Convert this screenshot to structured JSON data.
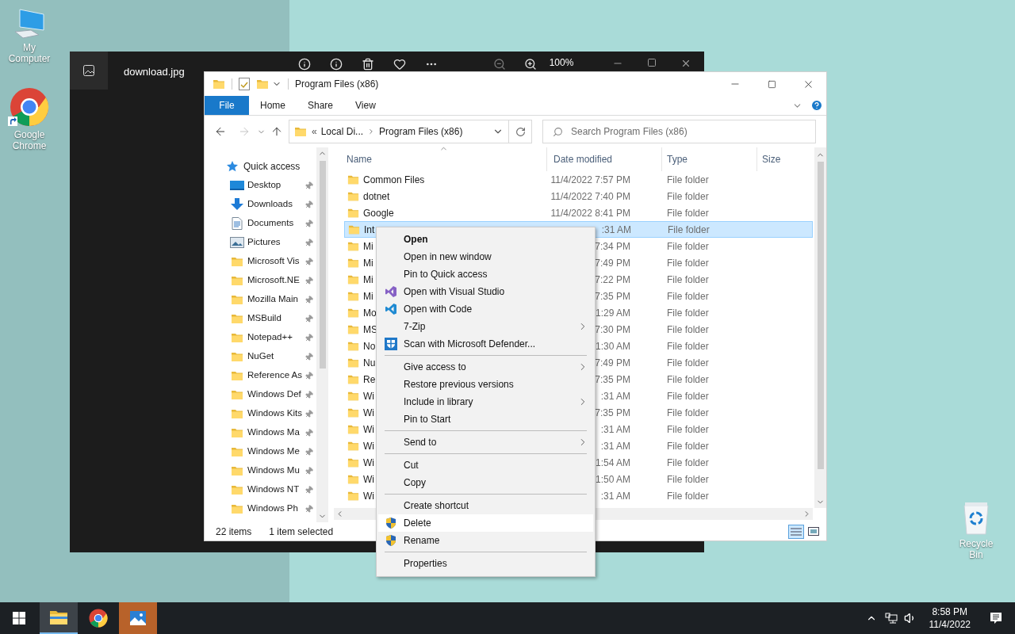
{
  "desktop_icons": [
    {
      "label": "My Computer",
      "kind": "computer"
    },
    {
      "label": "Google Chrome",
      "kind": "chrome"
    },
    {
      "label": "Recycle Bin",
      "kind": "recycle"
    }
  ],
  "photo_viewer": {
    "title": "download.jpg",
    "zoom": "100%"
  },
  "explorer": {
    "title": "Program Files (x86)",
    "ribbon_tabs": [
      {
        "label": "File",
        "selected": true
      },
      {
        "label": "Home",
        "selected": false
      },
      {
        "label": "Share",
        "selected": false
      },
      {
        "label": "View",
        "selected": false
      }
    ],
    "address": {
      "overflow": "«",
      "crumbs": [
        "Local Di...",
        "Program Files (x86)"
      ]
    },
    "search": {
      "placeholder": "Search Program Files (x86)"
    },
    "sidebar": {
      "items": [
        {
          "label": "Quick access",
          "kind": "star",
          "children": [
            {
              "label": "Desktop",
              "kind": "desktop",
              "pinned": true
            },
            {
              "label": "Downloads",
              "kind": "downloads",
              "pinned": true
            },
            {
              "label": "Documents",
              "kind": "documents",
              "pinned": true
            },
            {
              "label": "Pictures",
              "kind": "pictures",
              "pinned": true
            },
            {
              "label": "Microsoft Vis",
              "kind": "folder",
              "pinned": true
            },
            {
              "label": "Microsoft.NE",
              "kind": "folder",
              "pinned": true
            },
            {
              "label": "Mozilla Main",
              "kind": "folder",
              "pinned": true
            },
            {
              "label": "MSBuild",
              "kind": "folder",
              "pinned": true
            },
            {
              "label": "Notepad++",
              "kind": "folder",
              "pinned": true
            },
            {
              "label": "NuGet",
              "kind": "folder",
              "pinned": true
            },
            {
              "label": "Reference As",
              "kind": "folder",
              "pinned": true
            },
            {
              "label": "Windows Def",
              "kind": "folder",
              "pinned": true
            },
            {
              "label": "Windows Kits",
              "kind": "folder",
              "pinned": true
            },
            {
              "label": "Windows Ma",
              "kind": "folder",
              "pinned": true
            },
            {
              "label": "Windows Me",
              "kind": "folder",
              "pinned": true
            },
            {
              "label": "Windows Mu",
              "kind": "folder",
              "pinned": true
            },
            {
              "label": "Windows NT",
              "kind": "folder",
              "pinned": true
            },
            {
              "label": "Windows Ph",
              "kind": "folder",
              "pinned": true
            }
          ]
        }
      ]
    },
    "columns": [
      "Name",
      "Date modified",
      "Type",
      "Size"
    ],
    "rows": [
      {
        "name": "Common Files",
        "date": "11/4/2022 7:57 PM",
        "type": "File folder",
        "selected": false
      },
      {
        "name": "dotnet",
        "date": "11/4/2022 7:40 PM",
        "type": "File folder",
        "selected": false
      },
      {
        "name": "Google",
        "date": "11/4/2022 8:41 PM",
        "type": "File folder",
        "selected": false
      },
      {
        "name": "Int",
        "date": ":31 AM",
        "type": "File folder",
        "selected": true
      },
      {
        "name": "Mi",
        "date": "7:34 PM",
        "type": "File folder",
        "selected": false
      },
      {
        "name": "Mi",
        "date": "7:49 PM",
        "type": "File folder",
        "selected": false
      },
      {
        "name": "Mi",
        "date": "7:22 PM",
        "type": "File folder",
        "selected": false
      },
      {
        "name": "Mi",
        "date": "7:35 PM",
        "type": "File folder",
        "selected": false
      },
      {
        "name": "Mo",
        "date": "1:29 AM",
        "type": "File folder",
        "selected": false
      },
      {
        "name": "MS",
        "date": "7:30 PM",
        "type": "File folder",
        "selected": false
      },
      {
        "name": "No",
        "date": "1:30 AM",
        "type": "File folder",
        "selected": false
      },
      {
        "name": "Nu",
        "date": "7:49 PM",
        "type": "File folder",
        "selected": false
      },
      {
        "name": "Re",
        "date": "7:35 PM",
        "type": "File folder",
        "selected": false
      },
      {
        "name": "Wi",
        "date": ":31 AM",
        "type": "File folder",
        "selected": false
      },
      {
        "name": "Wi",
        "date": "7:35 PM",
        "type": "File folder",
        "selected": false
      },
      {
        "name": "Wi",
        "date": ":31 AM",
        "type": "File folder",
        "selected": false
      },
      {
        "name": "Wi",
        "date": ":31 AM",
        "type": "File folder",
        "selected": false
      },
      {
        "name": "Wi",
        "date": "1:54 AM",
        "type": "File folder",
        "selected": false
      },
      {
        "name": "Wi",
        "date": "1:50 AM",
        "type": "File folder",
        "selected": false
      },
      {
        "name": "Wi",
        "date": ":31 AM",
        "type": "File folder",
        "selected": false
      }
    ],
    "status": {
      "count": "22 items",
      "selection": "1 item selected"
    }
  },
  "context_menu": {
    "items": [
      {
        "kind": "item",
        "label": "Open",
        "default": true,
        "submenu": false,
        "highlighted": false
      },
      {
        "kind": "item",
        "label": "Open in new window",
        "default": false,
        "submenu": false,
        "highlighted": false
      },
      {
        "kind": "item",
        "label": "Pin to Quick access",
        "default": false,
        "submenu": false,
        "highlighted": false
      },
      {
        "kind": "vs",
        "label": "Open with Visual Studio",
        "default": false,
        "submenu": false,
        "highlighted": false
      },
      {
        "kind": "code",
        "label": "Open with Code",
        "default": false,
        "submenu": false,
        "highlighted": false
      },
      {
        "kind": "item",
        "label": "7-Zip",
        "default": false,
        "submenu": true,
        "highlighted": false
      },
      {
        "kind": "defender",
        "label": "Scan with Microsoft Defender...",
        "default": false,
        "submenu": false,
        "highlighted": false
      },
      {
        "kind": "separator"
      },
      {
        "kind": "item",
        "label": "Give access to",
        "default": false,
        "submenu": true,
        "highlighted": false
      },
      {
        "kind": "item",
        "label": "Restore previous versions",
        "default": false,
        "submenu": false,
        "highlighted": false
      },
      {
        "kind": "item",
        "label": "Include in library",
        "default": false,
        "submenu": true,
        "highlighted": false
      },
      {
        "kind": "item",
        "label": "Pin to Start",
        "default": false,
        "submenu": false,
        "highlighted": false
      },
      {
        "kind": "separator"
      },
      {
        "kind": "item",
        "label": "Send to",
        "default": false,
        "submenu": true,
        "highlighted": false
      },
      {
        "kind": "separator"
      },
      {
        "kind": "item",
        "label": "Cut",
        "default": false,
        "submenu": false,
        "highlighted": false
      },
      {
        "kind": "item",
        "label": "Copy",
        "default": false,
        "submenu": false,
        "highlighted": false
      },
      {
        "kind": "separator"
      },
      {
        "kind": "item",
        "label": "Create shortcut",
        "default": false,
        "submenu": false,
        "highlighted": false
      },
      {
        "kind": "shield",
        "label": "Delete",
        "default": false,
        "submenu": false,
        "highlighted": true
      },
      {
        "kind": "shield",
        "label": "Rename",
        "default": false,
        "submenu": false,
        "highlighted": false
      },
      {
        "kind": "separator"
      },
      {
        "kind": "item",
        "label": "Properties",
        "default": false,
        "submenu": false,
        "highlighted": false
      }
    ]
  },
  "taskbar": {
    "apps": [
      {
        "kind": "explorer",
        "selected": true
      },
      {
        "kind": "chrome",
        "selected": false
      },
      {
        "kind": "photos",
        "selected": false
      }
    ],
    "clock": {
      "time": "8:58 PM",
      "date": "11/4/2022"
    }
  }
}
